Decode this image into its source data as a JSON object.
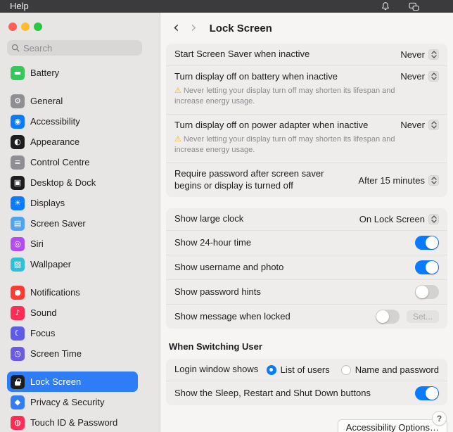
{
  "colors": {
    "accent": "#0a7aff",
    "sidebar_selected": "#2e7cf6",
    "warning": "#f6b60a"
  },
  "menubar": {
    "help_label": "Help",
    "icons": [
      "bell-icon",
      "screen-mirroring-icon"
    ]
  },
  "sidebar": {
    "search_placeholder": "Search",
    "items": [
      {
        "label": "Battery",
        "glyph": "▬",
        "color": "#34c759"
      },
      {
        "label": "General",
        "glyph": "⚙",
        "color": "#8e8e93"
      },
      {
        "label": "Accessibility",
        "glyph": "◉",
        "color": "#0a7aff"
      },
      {
        "label": "Appearance",
        "glyph": "◐",
        "color": "#1d1d1f"
      },
      {
        "label": "Control Centre",
        "glyph": "≡",
        "color": "#8e8e93"
      },
      {
        "label": "Desktop & Dock",
        "glyph": "▣",
        "color": "#1d1d1f"
      },
      {
        "label": "Displays",
        "glyph": "☀",
        "color": "#0a7aff"
      },
      {
        "label": "Screen Saver",
        "glyph": "▤",
        "color": "#4ea3f2"
      },
      {
        "label": "Siri",
        "glyph": "◎",
        "color": "#b14cf0"
      },
      {
        "label": "Wallpaper",
        "glyph": "▧",
        "color": "#2cc1d8"
      },
      {
        "label": "Notifications",
        "glyph": "●",
        "color": "#ff3b30"
      },
      {
        "label": "Sound",
        "glyph": "♪",
        "color": "#ff2d55"
      },
      {
        "label": "Focus",
        "glyph": "☾",
        "color": "#5e5ce6"
      },
      {
        "label": "Screen Time",
        "glyph": "◷",
        "color": "#6a5be2"
      },
      {
        "label": "Lock Screen",
        "glyph": "",
        "color": "#1d1d1f",
        "selected": true
      },
      {
        "label": "Privacy & Security",
        "glyph": "◆",
        "color": "#327cf6"
      },
      {
        "label": "Touch ID & Password",
        "glyph": "◍",
        "color": "#ff2d55"
      }
    ]
  },
  "header": {
    "title": "Lock Screen"
  },
  "settings": {
    "group1": {
      "row1": {
        "label": "Start Screen Saver when inactive",
        "value": "Never"
      },
      "row2": {
        "label": "Turn display off on battery when inactive",
        "value": "Never",
        "warning": "Never letting your display turn off may shorten its lifespan and increase energy usage."
      },
      "row3": {
        "label": "Turn display off on power adapter when inactive",
        "value": "Never",
        "warning": "Never letting your display turn off may shorten its lifespan and increase energy usage."
      },
      "row4": {
        "label": "Require password after screen saver begins or display is turned off",
        "value": "After 15 minutes"
      }
    },
    "group2": {
      "row1": {
        "label": "Show large clock",
        "value": "On Lock Screen"
      },
      "row2": {
        "label": "Show 24-hour time",
        "on": true
      },
      "row3": {
        "label": "Show username and photo",
        "on": true
      },
      "row4": {
        "label": "Show password hints",
        "on": false
      },
      "row5": {
        "label": "Show message when locked",
        "on": false,
        "button": "Set..."
      }
    },
    "section_title": "When Switching User",
    "group3": {
      "row1": {
        "label": "Login window shows",
        "options": [
          {
            "label": "List of users",
            "selected": true
          },
          {
            "label": "Name and password",
            "selected": false
          }
        ]
      },
      "row2": {
        "label": "Show the Sleep, Restart and Shut Down buttons",
        "on": true
      }
    },
    "footer": {
      "accessibility_button": "Accessibility Options…",
      "help_label": "?"
    }
  }
}
